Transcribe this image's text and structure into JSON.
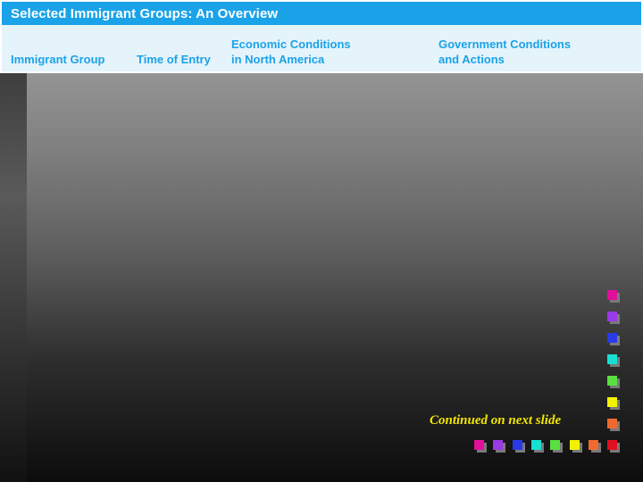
{
  "slide": {
    "title": "Selected Immigrant Groups: An Overview",
    "columns": [
      {
        "line1": "",
        "line2": "Immigrant Group"
      },
      {
        "line1": "",
        "line2": "Time of Entry"
      },
      {
        "line1": "Economic Conditions",
        "line2": "in North America"
      },
      {
        "line1": "Government Conditions",
        "line2": "and Actions"
      }
    ],
    "continued_text": "Continued on next slide"
  },
  "decor": {
    "vertical_squares": [
      "#e0109a",
      "#9a3ae8",
      "#2a3ae8",
      "#18e0d0",
      "#58e040",
      "#f2f200",
      "#f06a30"
    ],
    "bottom_squares": [
      "#e0109a",
      "#9a3ae8",
      "#2a3ae8",
      "#18e0d0",
      "#58e040",
      "#f2f200",
      "#f06a30",
      "#e01020"
    ]
  }
}
